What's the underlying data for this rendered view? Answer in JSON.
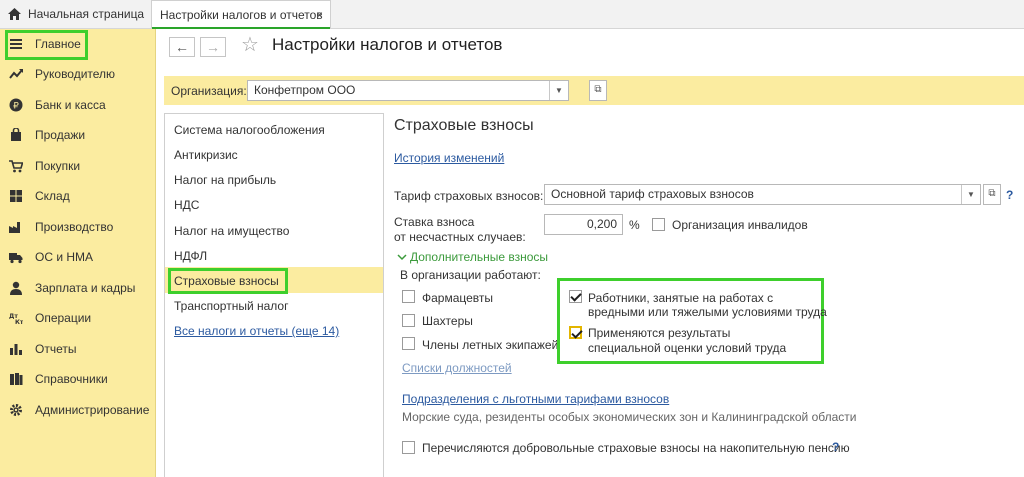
{
  "tabs": {
    "home_label": "Начальная страница",
    "active_label": "Настройки налогов и отчетов",
    "close_glyph": "×"
  },
  "sidebar": {
    "items": [
      {
        "label": "Главное",
        "icon": "menu-lines-icon"
      },
      {
        "label": "Руководителю",
        "icon": "trend-icon"
      },
      {
        "label": "Банк и касса",
        "icon": "ruble-coin-icon"
      },
      {
        "label": "Продажи",
        "icon": "shopping-bag-icon"
      },
      {
        "label": "Покупки",
        "icon": "cart-icon"
      },
      {
        "label": "Склад",
        "icon": "warehouse-grid-icon"
      },
      {
        "label": "Производство",
        "icon": "factory-icon"
      },
      {
        "label": "ОС и НМА",
        "icon": "truck-icon"
      },
      {
        "label": "Зарплата и кадры",
        "icon": "person-icon"
      },
      {
        "label": "Операции",
        "icon": "dt-kt-icon"
      },
      {
        "label": "Отчеты",
        "icon": "bar-chart-icon"
      },
      {
        "label": "Справочники",
        "icon": "books-icon"
      },
      {
        "label": "Администрирование",
        "icon": "gear-icon"
      }
    ]
  },
  "header": {
    "back_glyph": "←",
    "forward_glyph": "→",
    "star_glyph": "☆",
    "title": "Настройки налогов и отчетов"
  },
  "org": {
    "label": "Организация:",
    "value": "Конфетпром ООО"
  },
  "sections": {
    "items": [
      "Система налогообложения",
      "Антикризис",
      "Налог на прибыль",
      "НДС",
      "Налог на имущество",
      "НДФЛ",
      "Страховые взносы",
      "Транспортный налог"
    ],
    "all_link": "Все налоги и отчеты (еще 14)"
  },
  "content": {
    "heading": "Страховые взносы",
    "history_link": "История изменений",
    "tariff_label": "Тариф страховых взносов:",
    "tariff_value": "Основной тариф страховых взносов",
    "help_glyph": "?",
    "rate_label_1": "Ставка взноса",
    "rate_label_2": "от несчастных случаев:",
    "rate_value": "0,200",
    "rate_unit": "%",
    "disabled_org_label": "Организация инвалидов",
    "extra_header": "Дополнительные взносы",
    "works_label": "В организации работают:",
    "pharmacists": "Фармацевты",
    "miners": "Шахтеры",
    "flight_crew": "Члены летных экипажей",
    "positions_link": "Списки должностей",
    "hazard_line1": "Работники, занятые на работах с",
    "hazard_line2": "вредными или тяжелыми условиями труда",
    "assessment_line1": "Применяются результаты",
    "assessment_line2": "специальной оценки условий труда",
    "subdivisions_link": "Подразделения с льготными тарифами взносов",
    "subdivisions_desc": "Морские суда, резиденты особых экономических зон и Калининградской области",
    "voluntary_label": "Перечисляются добровольные страховые взносы на накопительную пенсию"
  },
  "colors": {
    "sidebar_bg": "#fbeca0",
    "accent_green": "#3ecf2c",
    "link_blue": "#2c5aa0",
    "selected_row": "#fbeca0"
  }
}
